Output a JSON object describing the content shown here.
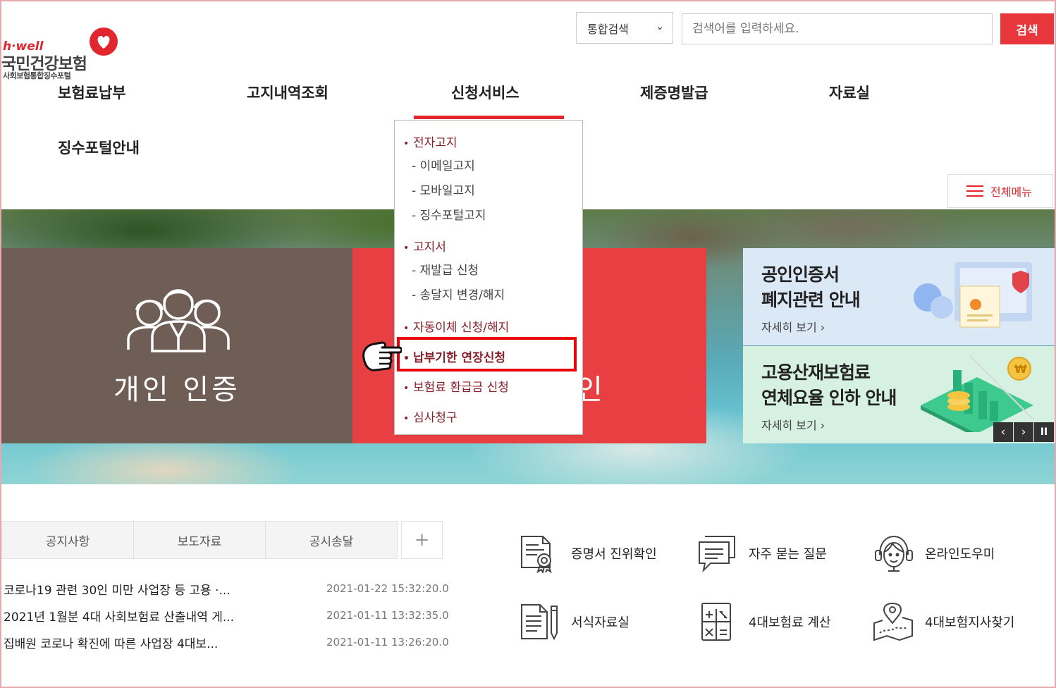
{
  "logo": {
    "tagline": "h·well",
    "name": "국민건강보험",
    "subtitle": "사회보험통합징수포털"
  },
  "search": {
    "scope_selected": "통합검색",
    "placeholder": "검색어를 입력하세요.",
    "button_label": "검색"
  },
  "nav": {
    "items": [
      "보험료납부",
      "고지내역조회",
      "신청서비스",
      "제증명발급",
      "자료실",
      "징수포털안내"
    ],
    "active_index": 2
  },
  "all_menu_label": "전체메뉴",
  "dropdown": {
    "groups": [
      {
        "label": "전자고지",
        "subs": [
          "- 이메일고지",
          "- 모바일고지",
          "- 징수포털고지"
        ]
      },
      {
        "label": "고지서",
        "subs": [
          "- 재발급 신청",
          "- 송달지 변경/해지"
        ]
      },
      {
        "label": "자동이체 신청/해지",
        "subs": []
      },
      {
        "label": "납부기한 연장신청",
        "subs": [],
        "highlighted": true
      },
      {
        "label": "보험료 환급금 신청",
        "subs": []
      },
      {
        "label": "심사청구",
        "subs": []
      }
    ]
  },
  "hero": {
    "personal_label": "개인 인증",
    "corporate_label_visible": "인",
    "cards": [
      {
        "line1": "공인인증서",
        "line2": "폐지관련 안내",
        "more": "자세히 보기 ›"
      },
      {
        "line1": "고용산재보험료",
        "line2": "연체요율 인하 안내",
        "more": "자세히 보기 ›"
      }
    ],
    "controls": [
      "‹",
      "›",
      "II"
    ]
  },
  "board": {
    "tabs": [
      "공지사항",
      "보도자료",
      "공시송달",
      "+"
    ],
    "notices": [
      {
        "title": "코로나19 관련 30인 미만 사업장 등 고용 ·...",
        "date": "2021-01-22 15:32:20.0"
      },
      {
        "title": "2021년 1월분 4대 사회보험료 산출내역 게...",
        "date": "2021-01-11 13:32:35.0"
      },
      {
        "title": "집배원 코로나 확진에 따른 사업장 4대보...",
        "date": "2021-01-11 13:26:20.0"
      }
    ]
  },
  "quick_links": [
    {
      "label": "증명서 진위확인",
      "icon": "certificate-icon"
    },
    {
      "label": "자주 묻는 질문",
      "icon": "chat-icon"
    },
    {
      "label": "온라인도우미",
      "icon": "headset-icon"
    },
    {
      "label": "서식자료실",
      "icon": "document-pen-icon"
    },
    {
      "label": "4대보험료 계산",
      "icon": "calculator-icon"
    },
    {
      "label": "4대보험지사찾기",
      "icon": "map-pin-icon"
    }
  ],
  "colors": {
    "accent": "#e1262d",
    "dropdown_text": "#8a1f2c",
    "personal_tile": "#6e5e55",
    "corporate_tile": "#e84042",
    "highlight_border": "#e8000b"
  }
}
